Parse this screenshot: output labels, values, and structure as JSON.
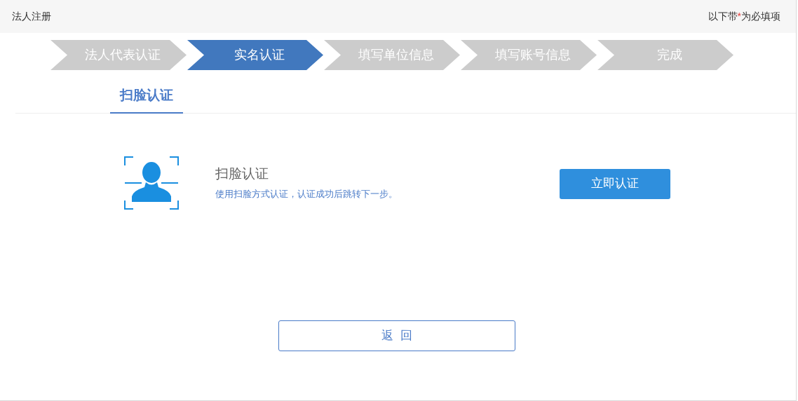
{
  "header": {
    "title": "法人注册",
    "required_note": {
      "before": "以下带",
      "mark": "*",
      "after": "为必填项"
    }
  },
  "steps": [
    {
      "label": "法人代表认证",
      "selected": false
    },
    {
      "label": "实名认证",
      "selected": true
    },
    {
      "label": "填写单位信息",
      "selected": false
    },
    {
      "label": "填写账号信息",
      "selected": false
    },
    {
      "label": "完成",
      "selected": false
    }
  ],
  "tabs": [
    {
      "label": "扫脸认证",
      "selected": true
    }
  ],
  "method": {
    "title": "扫脸认证",
    "description": "使用扫脸方式认证，认证成功后跳转下一步。",
    "button": "立即认证"
  },
  "back_button": "返  回"
}
